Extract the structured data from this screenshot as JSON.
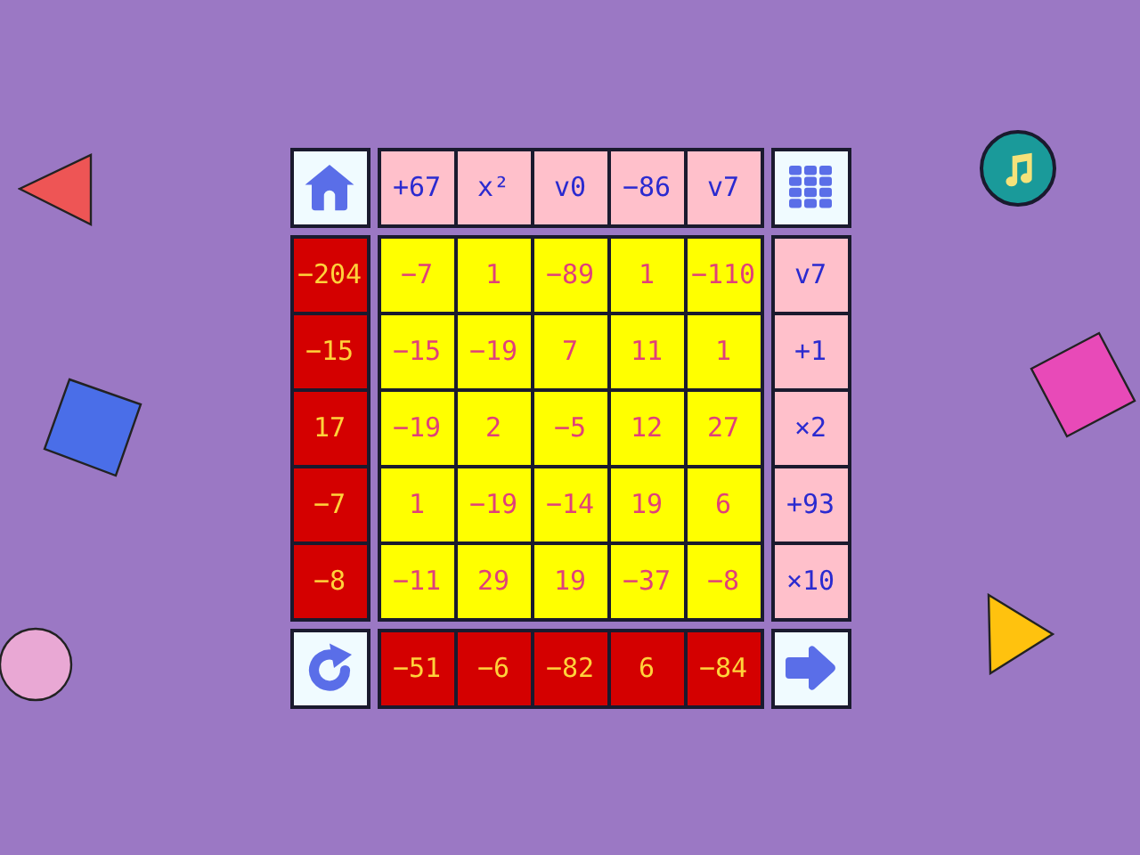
{
  "top_operations": [
    "+67",
    "x²",
    "v0",
    "−86",
    "v7"
  ],
  "left_values": [
    "−204",
    "−15",
    "17",
    "−7",
    "−8"
  ],
  "grid": [
    [
      "−7",
      "1",
      "−89",
      "1",
      "−110"
    ],
    [
      "−15",
      "−19",
      "7",
      "11",
      "1"
    ],
    [
      "−19",
      "2",
      "−5",
      "12",
      "27"
    ],
    [
      "1",
      "−19",
      "−14",
      "19",
      "6"
    ],
    [
      "−11",
      "29",
      "19",
      "−37",
      "−8"
    ]
  ],
  "right_operations": [
    "v7",
    "+1",
    "×2",
    "+93",
    "×10"
  ],
  "bottom_values": [
    "−51",
    "−6",
    "−82",
    "6",
    "−84"
  ]
}
